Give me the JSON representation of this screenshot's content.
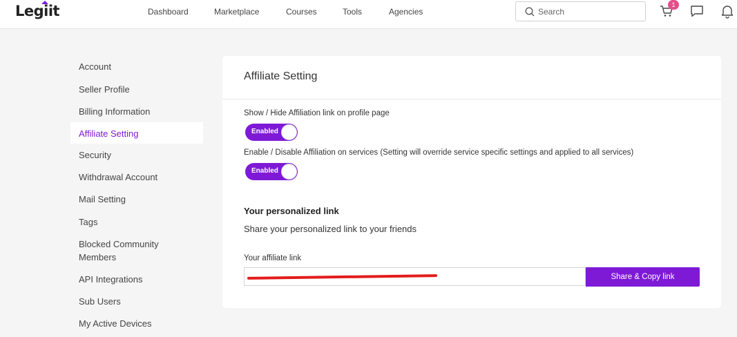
{
  "header": {
    "logo": "Legiit",
    "nav": [
      "Dashboard",
      "Marketplace",
      "Courses",
      "Tools",
      "Agencies"
    ],
    "search_placeholder": "Search",
    "cart_badge": "1",
    "brand_color": "#7e1ad6"
  },
  "sidebar": {
    "items": [
      {
        "label": "Account"
      },
      {
        "label": "Seller Profile"
      },
      {
        "label": "Billing Information"
      },
      {
        "label": "Affiliate Setting",
        "active": true
      },
      {
        "label": "Security"
      },
      {
        "label": "Withdrawal Account"
      },
      {
        "label": "Mail Setting"
      },
      {
        "label": "Tags"
      },
      {
        "label": "Blocked Community Members"
      },
      {
        "label": "API Integrations"
      },
      {
        "label": "Sub Users"
      },
      {
        "label": "My Active Devices"
      }
    ]
  },
  "main": {
    "title": "Affiliate Setting",
    "profile_link_label": "Show / Hide Affiliation link on profile page",
    "profile_link_toggle": "Enabled",
    "services_label": "Enable / Disable Affiliation on services (Setting will override service specific settings and applied to all services)",
    "services_toggle": "Enabled",
    "personal_link_heading": "Your personalized link",
    "personal_link_sub": "Share your personalized link to your friends",
    "affiliate_link_label": "Your affiliate link",
    "share_button": "Share & Copy link"
  }
}
